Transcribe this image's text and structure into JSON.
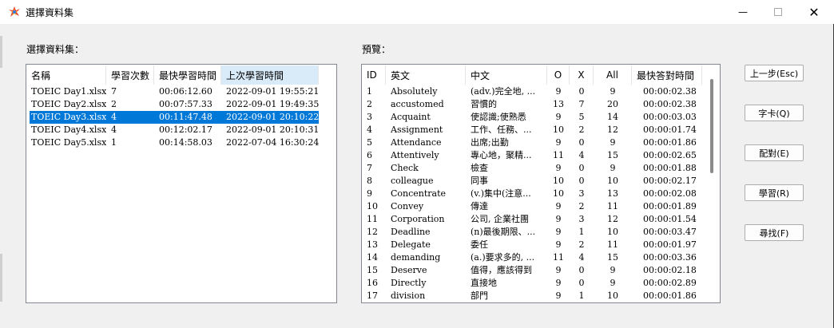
{
  "window": {
    "title": "選擇資料集",
    "minimize_glyph": "—",
    "close_glyph": "✕"
  },
  "left": {
    "label": "選擇資料集：",
    "columns": [
      "名稱",
      "學習次數",
      "最快學習時間",
      "上次學習時間"
    ],
    "rows": [
      [
        "TOEIC Day1.xlsx",
        "7",
        "00:06:12.60",
        "2022-09-01 19:55:21"
      ],
      [
        "TOEIC Day2.xlsx",
        "2",
        "00:07:57.33",
        "2022-09-01 19:49:35"
      ],
      [
        "TOEIC Day3.xlsx",
        "4",
        "00:11:47.48",
        "2022-09-01 20:10:22"
      ],
      [
        "TOEIC Day4.xlsx",
        "4",
        "00:12:02.17",
        "2022-09-01 20:10:31"
      ],
      [
        "TOEIC Day5.xlsx",
        "1",
        "00:14:58.03",
        "2022-07-04 16:30:24"
      ]
    ],
    "selected_index": 2
  },
  "preview": {
    "label": "預覽：",
    "columns": [
      "ID",
      "英文",
      "中文",
      "O",
      "X",
      "All",
      "最快答對時間"
    ],
    "rows": [
      [
        "1",
        "Absolutely",
        "(adv.)完全地, ...",
        "9",
        "0",
        "9",
        "00:00:02.38"
      ],
      [
        "2",
        "accustomed",
        "習慣的",
        "13",
        "7",
        "20",
        "00:00:02.38"
      ],
      [
        "3",
        "Acquaint",
        "使認識;使熟悉",
        "9",
        "5",
        "14",
        "00:00:03.03"
      ],
      [
        "4",
        "Assignment",
        "工作、任務、...",
        "10",
        "2",
        "12",
        "00:00:01.74"
      ],
      [
        "5",
        "Attendance",
        "出席;出勤",
        "9",
        "0",
        "9",
        "00:00:01.86"
      ],
      [
        "6",
        "Attentively",
        "專心地，聚精...",
        "11",
        "4",
        "15",
        "00:00:02.65"
      ],
      [
        "7",
        "Check",
        "檢查",
        "9",
        "0",
        "9",
        "00:00:01.88"
      ],
      [
        "8",
        "colleague",
        "同事",
        "10",
        "0",
        "10",
        "00:00:02.17"
      ],
      [
        "9",
        "Concentrate",
        "(v.)集中(注意...",
        "10",
        "3",
        "13",
        "00:00:02.08"
      ],
      [
        "10",
        "Convey",
        "傳達",
        "9",
        "2",
        "11",
        "00:00:01.89"
      ],
      [
        "11",
        "Corporation",
        "公司, 企業社團",
        "9",
        "3",
        "12",
        "00:00:01.54"
      ],
      [
        "12",
        "Deadline",
        "(n)最後期限、...",
        "9",
        "1",
        "10",
        "00:00:03.47"
      ],
      [
        "13",
        "Delegate",
        "委任",
        "9",
        "2",
        "11",
        "00:00:01.97"
      ],
      [
        "14",
        "demanding",
        "(a.)要求多的, ...",
        "11",
        "4",
        "15",
        "00:00:03.36"
      ],
      [
        "15",
        "Deserve",
        "值得，應該得到",
        "9",
        "0",
        "9",
        "00:00:02.18"
      ],
      [
        "16",
        "Directly",
        "直接地",
        "9",
        "0",
        "9",
        "00:00:02.89"
      ],
      [
        "17",
        "division",
        "部門",
        "9",
        "1",
        "10",
        "00:00:01.86"
      ]
    ]
  },
  "buttons": [
    "上一步(Esc)",
    "字卡(Q)",
    "配對(E)",
    "學習(R)",
    "尋找(F)"
  ],
  "icons": {
    "app": "app-logo-icon",
    "minimize": "minimize-icon",
    "maximize": "maximize-icon",
    "close": "close-icon"
  },
  "colors": {
    "selection": "#0078d7",
    "active_header": "#d9ebf9"
  }
}
